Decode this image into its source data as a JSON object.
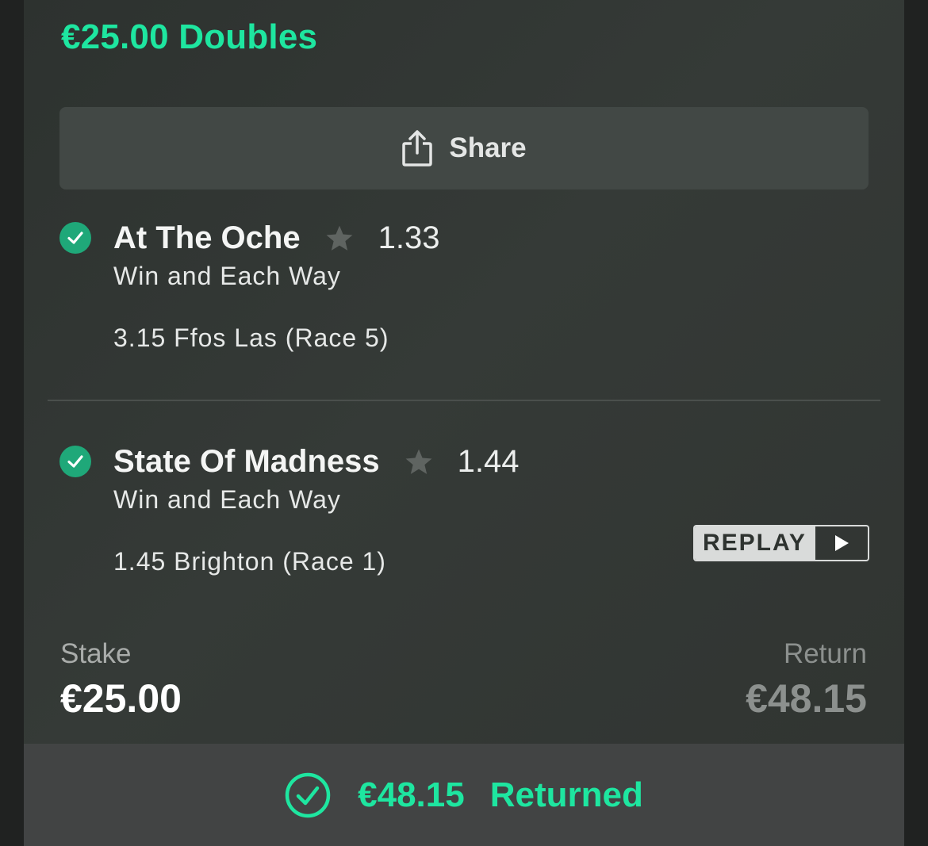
{
  "bet": {
    "title": "€25.00 Doubles",
    "share_label": "Share",
    "legs": [
      {
        "selection": "At The Oche",
        "odds": "1.33",
        "market": "Win and Each Way",
        "event": "3.15 Ffos Las (Race 5)",
        "status_icon": "check-circle-icon"
      },
      {
        "selection": "State Of Madness",
        "odds": "1.44",
        "market": "Win and Each Way",
        "event": "1.45 Brighton (Race 1)",
        "status_icon": "check-circle-icon",
        "replay_label": "REPLAY"
      }
    ],
    "stake_label": "Stake",
    "stake_value": "€25.00",
    "return_label": "Return",
    "return_value": "€48.15"
  },
  "footer": {
    "amount": "€48.15",
    "status": "Returned"
  },
  "colors": {
    "accent": "#1ee6a0",
    "check": "#1fa879",
    "card_bg": "#323734",
    "footer_bg": "#424444"
  }
}
